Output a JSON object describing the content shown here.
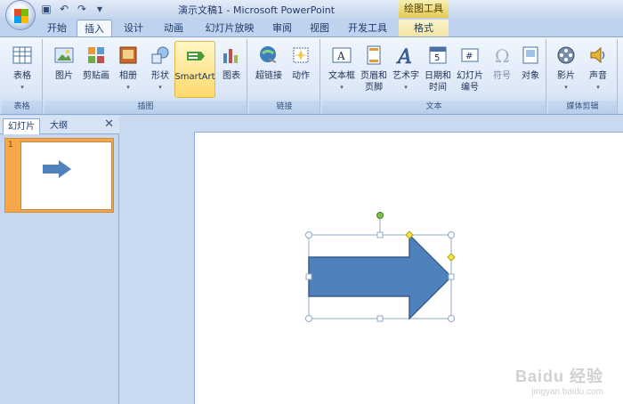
{
  "app": {
    "title": "演示文稿1 - Microsoft PowerPoint",
    "context_tool_label": "绘图工具"
  },
  "qat_icons": [
    "save-icon",
    "undo-icon",
    "redo-icon",
    "customize-icon"
  ],
  "tabs": [
    "开始",
    "插入",
    "设计",
    "动画",
    "幻灯片放映",
    "审阅",
    "视图",
    "开发工具",
    "格式"
  ],
  "active_tab": "插入",
  "ribbon": {
    "groups": [
      {
        "label": "表格",
        "buttons": [
          {
            "label": "表格",
            "caret": true,
            "icon": "table-icon"
          }
        ]
      },
      {
        "label": "插图",
        "buttons": [
          {
            "label": "图片",
            "icon": "picture-icon"
          },
          {
            "label": "剪贴画",
            "icon": "clipart-icon"
          },
          {
            "label": "相册",
            "caret": true,
            "icon": "photo-album-icon"
          },
          {
            "label": "形状",
            "caret": true,
            "icon": "shapes-icon"
          },
          {
            "label": "SmartArt",
            "icon": "smartart-icon",
            "highlighted": true
          },
          {
            "label": "图表",
            "icon": "chart-icon"
          }
        ]
      },
      {
        "label": "链接",
        "buttons": [
          {
            "label": "超链接",
            "icon": "hyperlink-icon"
          },
          {
            "label": "动作",
            "icon": "action-icon"
          }
        ]
      },
      {
        "label": "文本",
        "buttons": [
          {
            "label": "文本框",
            "caret": true,
            "icon": "textbox-icon"
          },
          {
            "label": "页眉和\n页脚",
            "icon": "header-footer-icon"
          },
          {
            "label": "艺术字",
            "caret": true,
            "icon": "wordart-icon"
          },
          {
            "label": "日期和\n时间",
            "icon": "datetime-icon"
          },
          {
            "label": "幻灯片\n编号",
            "icon": "slide-number-icon"
          },
          {
            "label": "符号",
            "icon": "symbol-icon",
            "disabled": true
          },
          {
            "label": "对象",
            "icon": "object-icon"
          }
        ]
      },
      {
        "label": "媒体剪辑",
        "buttons": [
          {
            "label": "影片",
            "caret": true,
            "icon": "movie-icon"
          },
          {
            "label": "声音",
            "caret": true,
            "icon": "sound-icon"
          }
        ]
      }
    ]
  },
  "slide_panel": {
    "tabs": [
      "幻灯片",
      "大纲"
    ],
    "close_symbol": "✕",
    "slides": [
      {
        "number": "1"
      }
    ]
  },
  "colors": {
    "arrow_fill": "#4f81bd",
    "arrow_stroke": "#385d8a",
    "handle": "#8fa8c8",
    "adjust_handle": "#f4e542",
    "rotate_handle": "#7ac142"
  },
  "watermark": {
    "logo": "Baidu 经验",
    "url": "jingyan.baidu.com"
  }
}
